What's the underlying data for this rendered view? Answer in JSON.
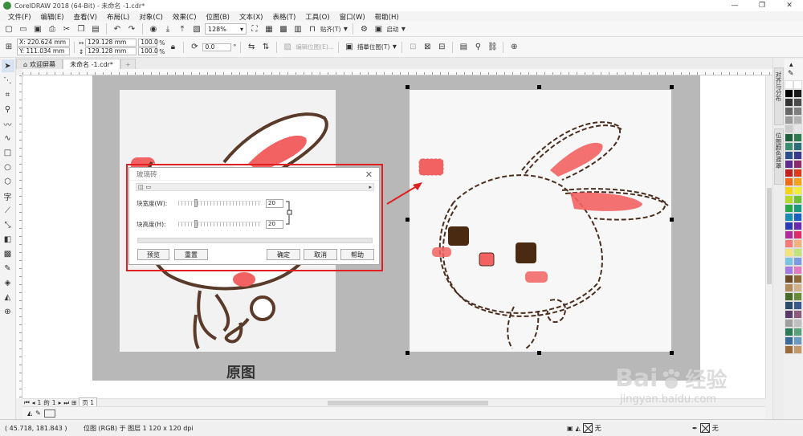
{
  "window": {
    "title": "CorelDRAW 2018 (64-Bit) - 未命名 -1.cdr*",
    "min": "—",
    "max": "❐",
    "close": "✕"
  },
  "menu": [
    "文件(F)",
    "编辑(E)",
    "查看(V)",
    "布局(L)",
    "对象(C)",
    "效果(C)",
    "位图(B)",
    "文本(X)",
    "表格(T)",
    "工具(O)",
    "窗口(W)",
    "帮助(H)"
  ],
  "toolbar": {
    "zoom_value": "128%",
    "snap_label": "贴齐(T)",
    "launch_label": "启动"
  },
  "propbar": {
    "x_value": "X: 220.624 mm",
    "y_value": "Y: 111.034 mm",
    "w_value": "129.128 mm",
    "h_value": "129.128 mm",
    "scale_w": "100.0",
    "scale_h": "100.0",
    "pct": "%",
    "rotate_value": "0.0",
    "degree": "°",
    "edit_bitmap": "编辑位图(E)...",
    "trace_bitmap": "描摹位图(T)"
  },
  "tabs": {
    "welcome": "欢迎屏幕",
    "doc": "未命名 -1.cdr*"
  },
  "dialog": {
    "title": "玻璃砖",
    "width_label": "块宽度(W):",
    "width_value": "20",
    "height_label": "块高度(H):",
    "height_value": "20",
    "preview": "预览",
    "reset": "重置",
    "ok": "确定",
    "cancel": "取消",
    "help": "帮助"
  },
  "canvas": {
    "caption": "原图"
  },
  "dockers": {
    "align": "对齐与分布",
    "bitmap_color": "位图颜色遮罩"
  },
  "pagenav": {
    "page_num": "1",
    "of": "的",
    "total": "1",
    "page_tab": "页 1"
  },
  "status": {
    "coords": "( 45.718, 181.843 )",
    "object_info": "位图 (RGB) 于 图层 1 120 x 120 dpi",
    "fill_none": "无",
    "outline_none": "无"
  },
  "watermark": {
    "brand": "Bai",
    "brand_cn": "经验",
    "url": "jingyan.baidu.com"
  },
  "palette_colors": [
    "#ffffff",
    "#ffffff",
    "#000000",
    "#1a1a1a",
    "#333333",
    "#4d4d4d",
    "#666666",
    "#808080",
    "#999999",
    "#b3b3b3",
    "#cccccc",
    "#e6e6e6",
    "#1f5e3a",
    "#2f7a4f",
    "#3b8c6e",
    "#2a6f7a",
    "#2b4f8c",
    "#3a3a8c",
    "#5b2c8c",
    "#8c2c6e",
    "#c02020",
    "#e03a1a",
    "#f06a1a",
    "#f4a21a",
    "#f7d21a",
    "#f2ee3a",
    "#b8d82a",
    "#6ec03a",
    "#2aa84a",
    "#1a9a7a",
    "#1a8cb0",
    "#1a5ec0",
    "#2a3ab0",
    "#6a2ab0",
    "#b02a9a",
    "#e02a6a",
    "#f47a7a",
    "#f4b27a",
    "#f4e27a",
    "#c2e27a",
    "#7ac2e2",
    "#7a9ae2",
    "#a27ae2",
    "#e27ac2",
    "#6b4a2a",
    "#8c6a3a",
    "#b08a5a",
    "#d2b28a",
    "#4a6a2a",
    "#6a8c3a",
    "#2a4a6a",
    "#3a5a8c",
    "#5a3a6a",
    "#8c5a7a",
    "#a0a0a0",
    "#c0c0c0",
    "#2a7a5a",
    "#5aa07a",
    "#3a6a9a",
    "#6a9ac0",
    "#9a6a3a",
    "#c09a6a"
  ]
}
